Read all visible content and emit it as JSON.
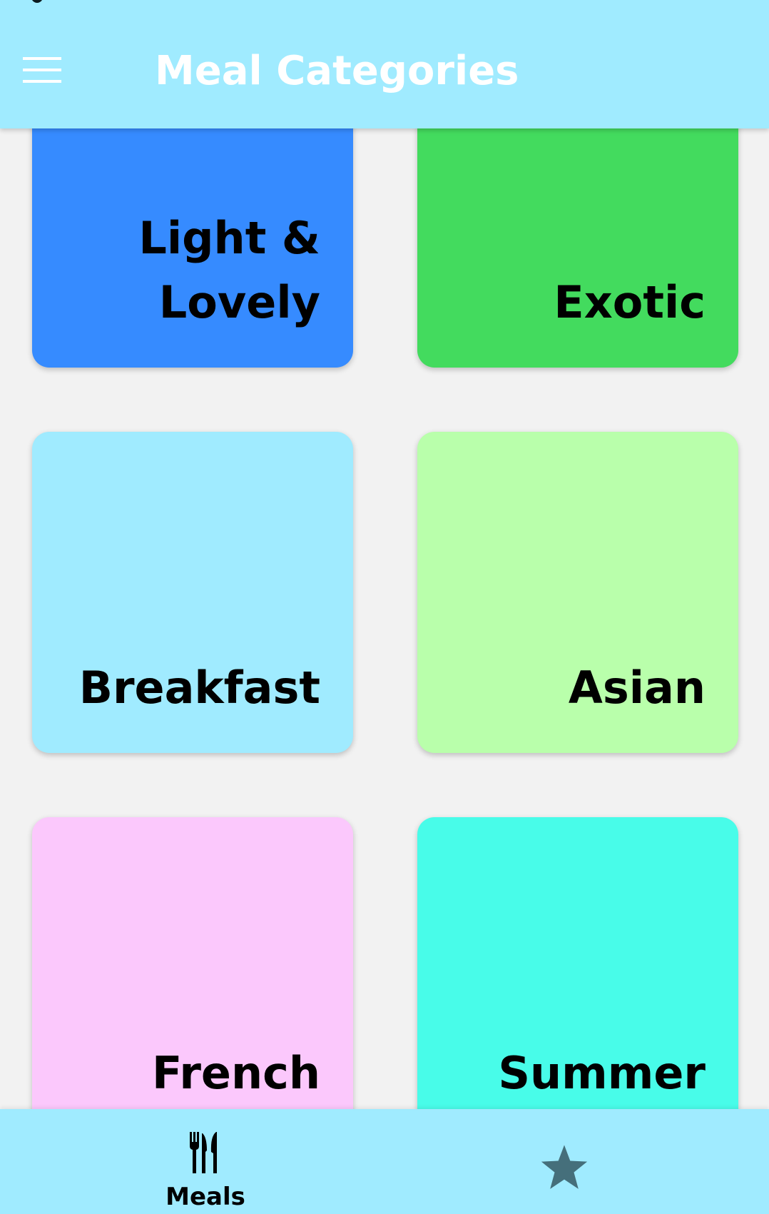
{
  "header": {
    "title": "Meal Categories",
    "menu_icon": "hamburger-menu-icon",
    "background": "#a0ebff"
  },
  "categories": [
    {
      "label": "Light &\nLovely",
      "color": "#368bff"
    },
    {
      "label": "Exotic",
      "color": "#43db5e"
    },
    {
      "label": "Breakfast",
      "color": "#a0ebff"
    },
    {
      "label": "Asian",
      "color": "#b9ffab"
    },
    {
      "label": "French",
      "color": "#fbc8fc"
    },
    {
      "label": "Summer",
      "color": "#48fce9"
    }
  ],
  "bottom_nav": {
    "items": [
      {
        "label": "Meals",
        "icon": "cutlery-icon",
        "active": true
      },
      {
        "label": "",
        "icon": "star-icon",
        "active": false
      }
    ],
    "inactive_color": "#456f7b"
  }
}
